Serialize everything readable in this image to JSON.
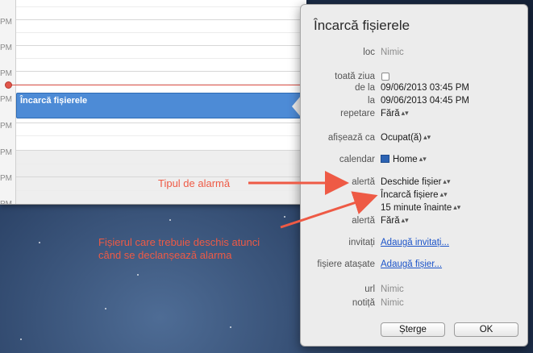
{
  "calendar": {
    "time_labels": [
      "PM",
      "PM",
      "PM",
      "PM",
      "PM",
      "PM",
      "PM",
      "PM"
    ],
    "event_title": "Încarcă fișierele"
  },
  "popover": {
    "title": "Încarcă fișierele",
    "fields": {
      "location_label": "loc",
      "location_value": "Nimic",
      "allday_label": "toată ziua",
      "from_label": "de la",
      "from_value": "09/06/2013  03:45 PM",
      "to_label": "la",
      "to_value": "09/06/2013  04:45 PM",
      "repeat_label": "repetare",
      "repeat_value": "Fără",
      "show_as_label": "afișează ca",
      "show_as_value": "Ocupat(ă)",
      "calendar_label": "calendar",
      "calendar_value": "Home",
      "calendar_color": "#2c63b3",
      "alert_label": "alertă",
      "alert_type_value": "Deschide fișier",
      "alert_file_value": "Încarcă fișiere",
      "alert_time_value": "15  minute înainte",
      "alert2_label": "alertă",
      "alert2_value": "Fără",
      "invitees_label": "invitați",
      "invitees_link": "Adaugă invitați...",
      "attachments_label": "fișiere atașate",
      "attachments_link": "Adaugă fișier...",
      "url_label": "url",
      "url_value": "Nimic",
      "note_label": "notiță",
      "note_value": "Nimic"
    },
    "buttons": {
      "delete": "Șterge",
      "ok": "OK"
    }
  },
  "annotations": {
    "alarm_type": "Tipul de alarmă",
    "file_line1": "Fișierul care trebuie deschis atunci",
    "file_line2": "când se declanșează alarma",
    "color": "#ee5a45"
  }
}
